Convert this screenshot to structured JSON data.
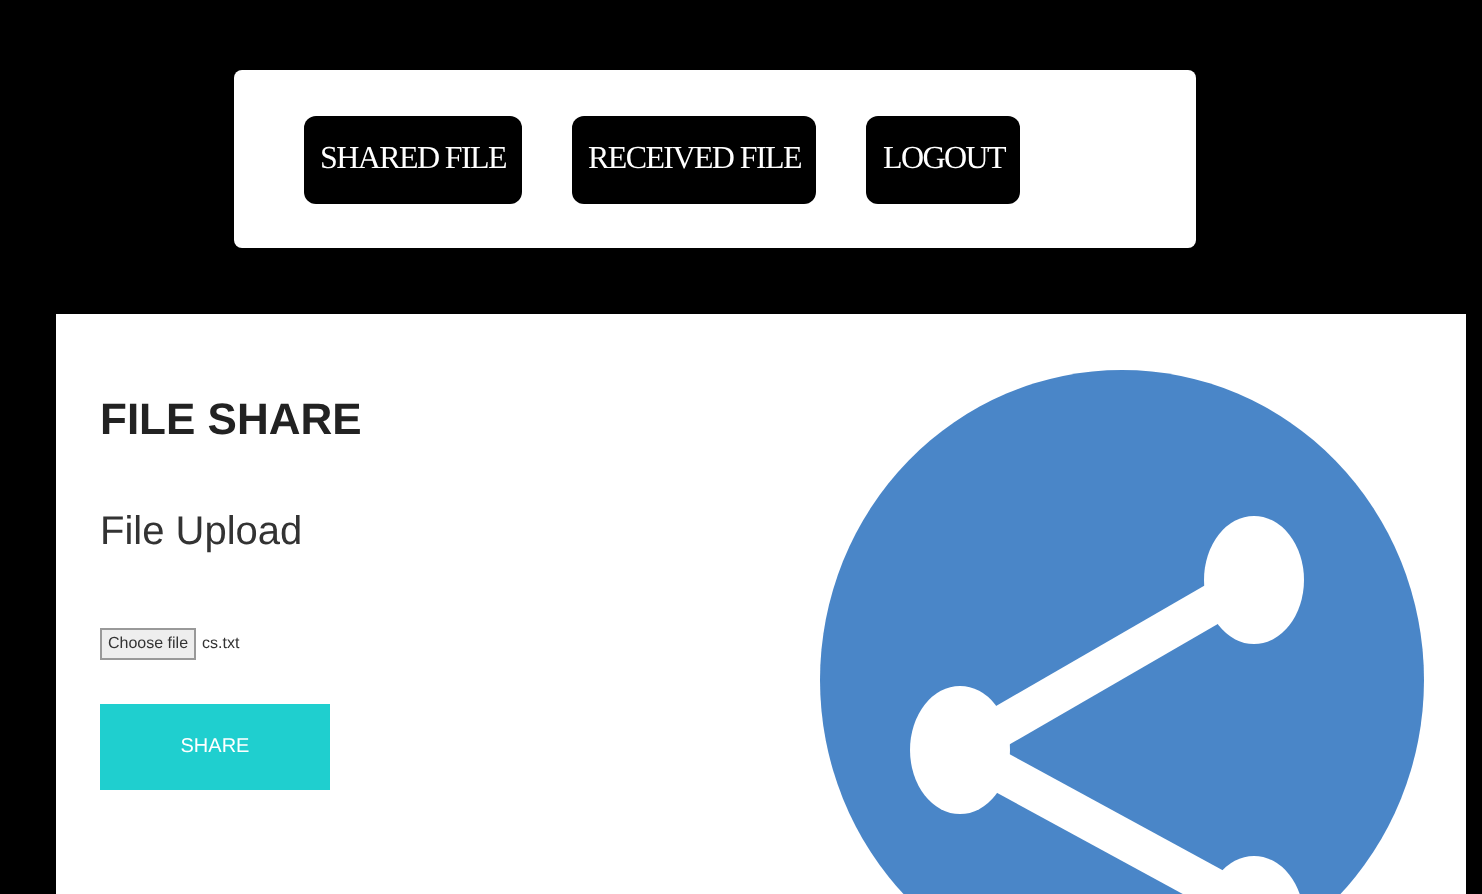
{
  "nav": {
    "buttons": [
      "SHARED FILE",
      "RECEIVED FILE",
      "LOGOUT"
    ]
  },
  "card": {
    "title": "FILE SHARE",
    "subtitle": "File Upload",
    "file_input": {
      "button": "Choose file",
      "value": "cs.txt"
    },
    "submit": "SHARE"
  }
}
